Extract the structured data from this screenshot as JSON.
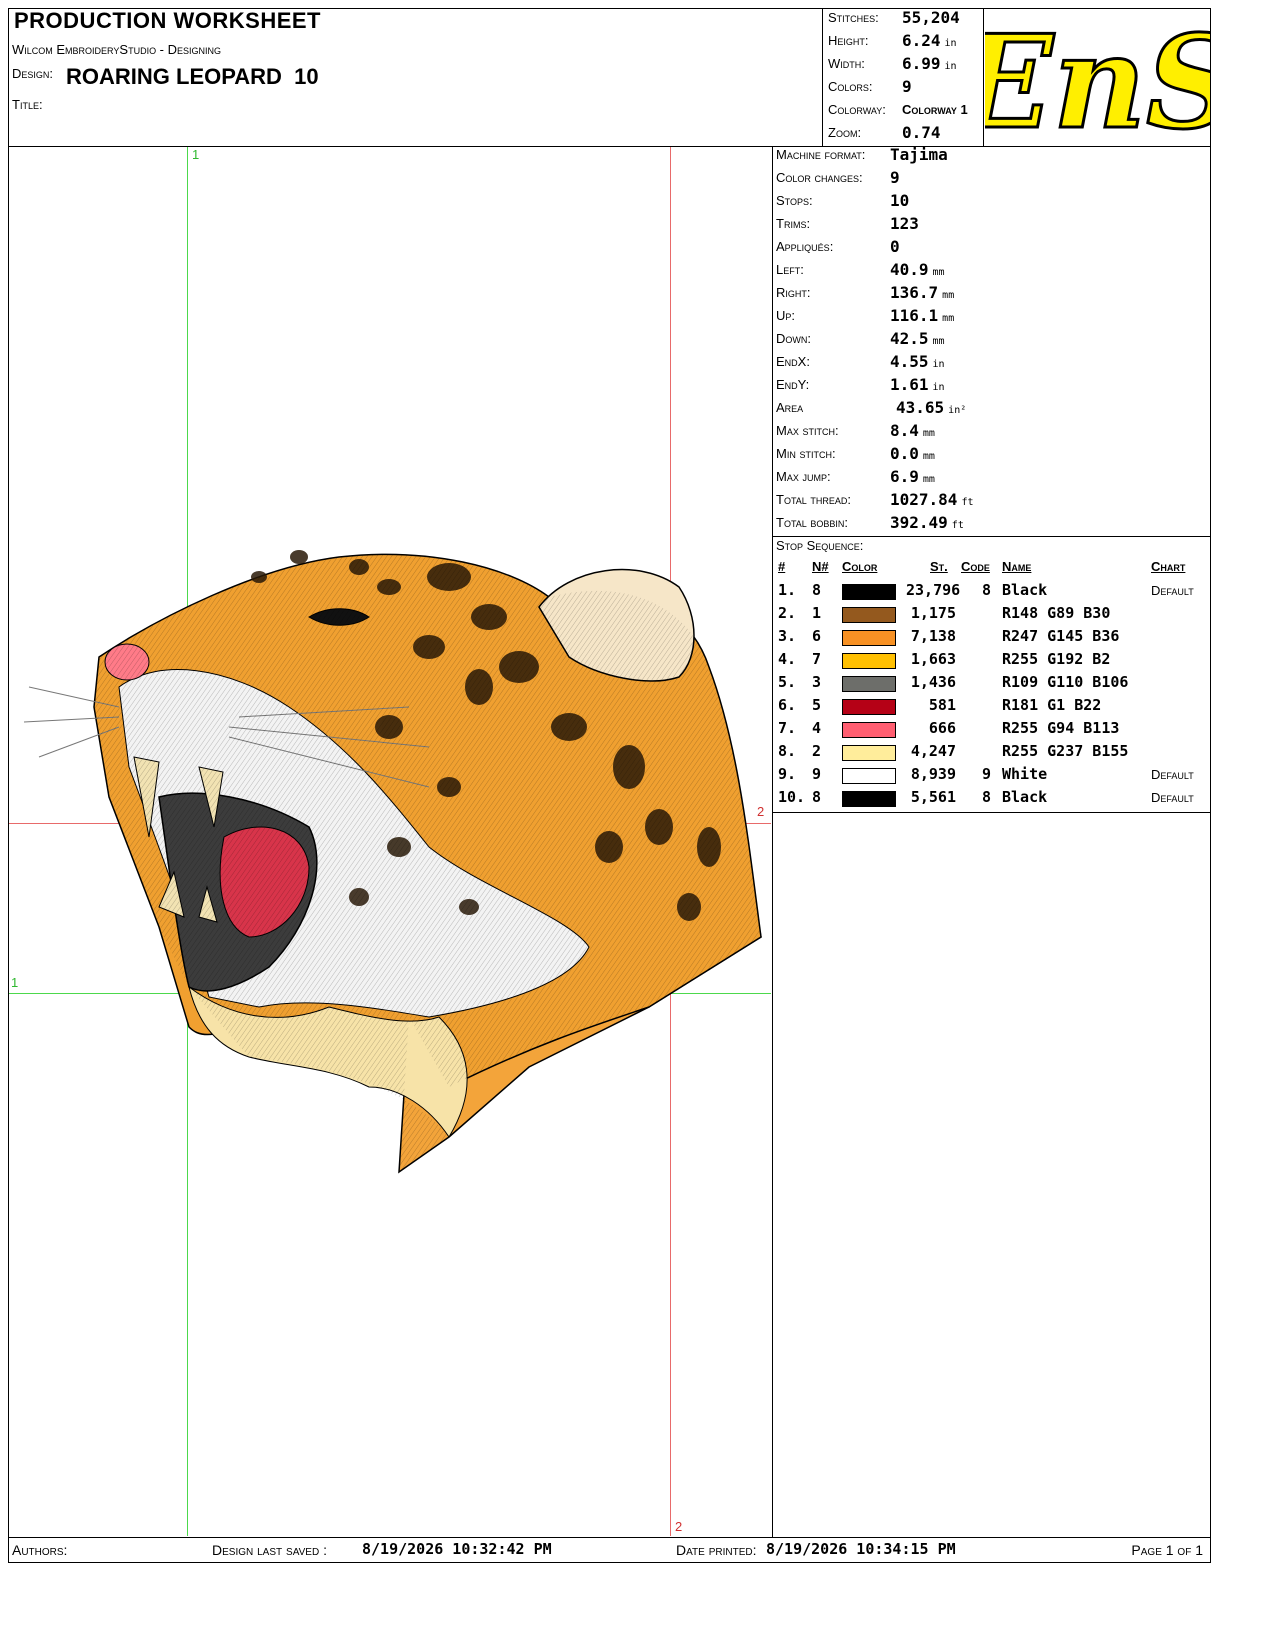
{
  "header": {
    "title": "PRODUCTION WORKSHEET",
    "software": "Wilcom EmbroideryStudio - Designing",
    "design_label": "Design:",
    "design_name": "ROARING LEOPARD  10",
    "title_label": "Title:"
  },
  "summary": {
    "stitches_label": "Stitches:",
    "stitches": "55,204",
    "height_label": "Height:",
    "height": "6.24",
    "height_unit": "in",
    "width_label": "Width:",
    "width": "6.99",
    "width_unit": "in",
    "colors_label": "Colors:",
    "colors": "9",
    "colorway_label": "Colorway:",
    "colorway": "Colorway 1",
    "zoom_label": "Zoom:",
    "zoom": "0.74"
  },
  "logo": {
    "text": "EnS",
    "bg": "#ffffff",
    "fill": "#ffef00"
  },
  "stats": [
    {
      "label": "Machine format:",
      "value": "Tajima",
      "unit": ""
    },
    {
      "label": "Color changes:",
      "value": "9",
      "unit": ""
    },
    {
      "label": "Stops:",
      "value": "10",
      "unit": ""
    },
    {
      "label": "Trims:",
      "value": "123",
      "unit": ""
    },
    {
      "label": "Appliqués:",
      "value": "0",
      "unit": ""
    },
    {
      "label": "Left:",
      "value": "40.9",
      "unit": "mm"
    },
    {
      "label": "Right:",
      "value": "136.7",
      "unit": "mm"
    },
    {
      "label": "Up:",
      "value": "116.1",
      "unit": "mm"
    },
    {
      "label": "Down:",
      "value": "42.5",
      "unit": "mm"
    },
    {
      "label": "EndX:",
      "value": "4.55",
      "unit": "in"
    },
    {
      "label": "EndY:",
      "value": "1.61",
      "unit": "in"
    },
    {
      "label": "Area",
      "value": "43.65",
      "unit": "in²"
    },
    {
      "label": "Max stitch:",
      "value": "8.4",
      "unit": "mm"
    },
    {
      "label": "Min stitch:",
      "value": "0.0",
      "unit": "mm"
    },
    {
      "label": "Max jump:",
      "value": "6.9",
      "unit": "mm"
    },
    {
      "label": "Total thread:",
      "value": "1027.84",
      "unit": "ft"
    },
    {
      "label": "Total bobbin:",
      "value": "392.49",
      "unit": "ft"
    }
  ],
  "stop_sequence": {
    "title": "Stop Sequence:",
    "headers": {
      "idx": "#",
      "n": "N#",
      "color": "Color",
      "st": "St.",
      "code": "Code",
      "name": "Name",
      "chart": "Chart"
    },
    "rows": [
      {
        "idx": "1.",
        "n": "8",
        "color": "#000000",
        "st": "23,796",
        "code": "8",
        "name": "Black",
        "chart": "Default"
      },
      {
        "idx": "2.",
        "n": "1",
        "color": "#94591e",
        "st": "1,175",
        "code": "",
        "name": "R148 G89 B30",
        "chart": ""
      },
      {
        "idx": "3.",
        "n": "6",
        "color": "#f79124",
        "st": "7,138",
        "code": "",
        "name": "R247 G145 B36",
        "chart": ""
      },
      {
        "idx": "4.",
        "n": "7",
        "color": "#ffc002",
        "st": "1,663",
        "code": "",
        "name": "R255 G192 B2",
        "chart": ""
      },
      {
        "idx": "5.",
        "n": "3",
        "color": "#6d6e6a",
        "st": "1,436",
        "code": "",
        "name": "R109 G110 B106",
        "chart": ""
      },
      {
        "idx": "6.",
        "n": "5",
        "color": "#b50116",
        "st": "581",
        "code": "",
        "name": "R181 G1 B22",
        "chart": ""
      },
      {
        "idx": "7.",
        "n": "4",
        "color": "#ff5e71",
        "st": "666",
        "code": "",
        "name": "R255 G94 B113",
        "chart": ""
      },
      {
        "idx": "8.",
        "n": "2",
        "color": "#ffed9b",
        "st": "4,247",
        "code": "",
        "name": "R255 G237 B155",
        "chart": ""
      },
      {
        "idx": "9.",
        "n": "9",
        "color": "#ffffff",
        "st": "8,939",
        "code": "9",
        "name": "White",
        "chart": "Default"
      },
      {
        "idx": "10.",
        "n": "8",
        "color": "#000000",
        "st": "5,561",
        "code": "8",
        "name": "Black",
        "chart": "Default"
      }
    ]
  },
  "guides": {
    "v1": "1",
    "h1": "1",
    "v2": "2",
    "h2": "2"
  },
  "footer": {
    "authors_label": "Authors:",
    "saved_label": "Design last saved :",
    "saved_value": "8/19/2026 10:32:42 PM",
    "printed_label": "Date printed:",
    "printed_value": "8/19/2026 10:34:15 PM",
    "page": "Page 1 of 1"
  }
}
